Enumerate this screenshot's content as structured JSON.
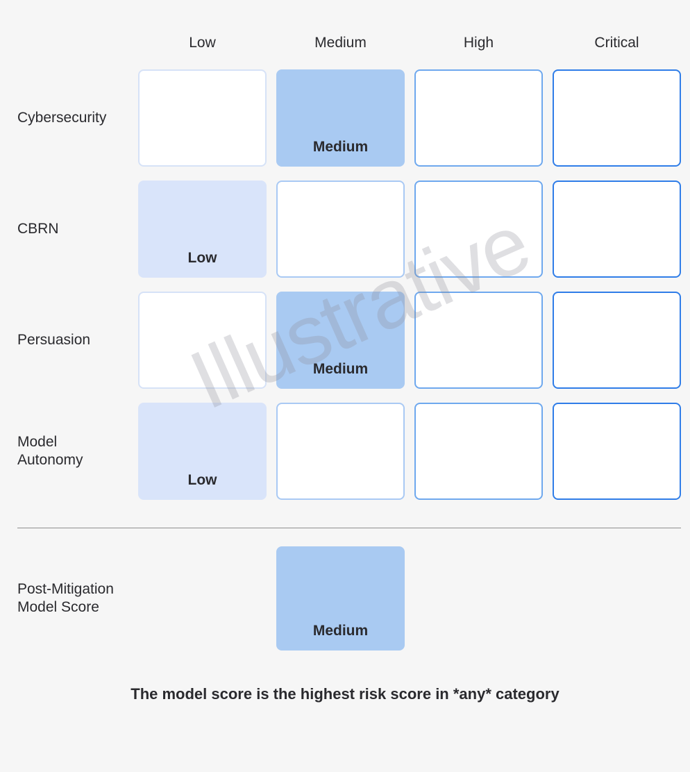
{
  "watermark": "Illustrative",
  "columns": {
    "low": "Low",
    "medium": "Medium",
    "high": "High",
    "critical": "Critical"
  },
  "rows": {
    "cybersecurity": {
      "label": "Cybersecurity",
      "selected": "medium",
      "selected_label": "Medium"
    },
    "cbrn": {
      "label": "CBRN",
      "selected": "low",
      "selected_label": "Low"
    },
    "persuasion": {
      "label": "Persuasion",
      "selected": "medium",
      "selected_label": "Medium"
    },
    "model_autonomy": {
      "label": "Model Autonomy",
      "selected": "low",
      "selected_label": "Low"
    }
  },
  "summary": {
    "label": "Post-Mitigation Model Score",
    "selected": "medium",
    "selected_label": "Medium"
  },
  "footer": "The model score is the highest risk score in *any* category"
}
